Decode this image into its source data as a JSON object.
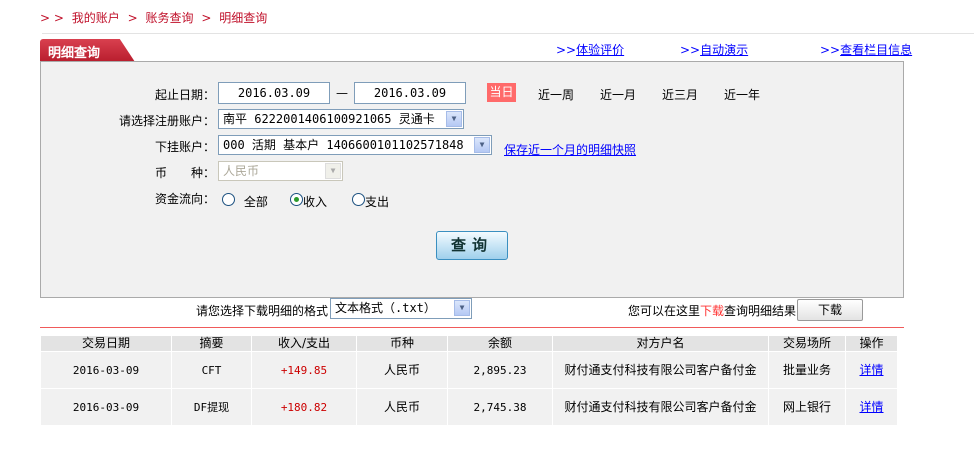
{
  "breadcrumb": {
    "prefix": "> >",
    "items": [
      "我的账户",
      "账务查询",
      "明细查询"
    ],
    "sep": ">"
  },
  "tab": {
    "title": "明细查询"
  },
  "top_links": [
    {
      "prefix": ">>",
      "label": "体验评价"
    },
    {
      "prefix": ">>",
      "label": "自动演示"
    },
    {
      "prefix": ">>",
      "label": "查看栏目信息"
    }
  ],
  "form": {
    "date_label": "起止日期：",
    "start_date": "2016.03.09",
    "dash": "—",
    "end_date": "2016.03.09",
    "quick": [
      "当日",
      "近一周",
      "近一月",
      "近三月",
      "近一年"
    ],
    "account_label": "请选择注册账户：",
    "account_value": "南平  6222001406100921065  灵通卡",
    "sub_label": "下挂账户：",
    "sub_value": "000  活期  基本户  1406600101102571848",
    "snapshot_link": "保存近一个月的明细快照",
    "currency_label": "币　　种：",
    "currency_value": "人民币",
    "flow_label": "资金流向：",
    "flow_options": [
      "全部",
      "收入",
      "支出"
    ],
    "flow_selected": "收入",
    "query_button": "查询"
  },
  "download": {
    "format_label": "请您选择下载明细的格式",
    "format_value": "文本格式（.txt）",
    "hint_pre": "您可以在这里",
    "hint_red": "下载",
    "hint_post": "查询明细结果",
    "button": "下载"
  },
  "table": {
    "headers": [
      "交易日期",
      "摘要",
      "收入/支出",
      "币种",
      "余额",
      "对方户名",
      "交易场所",
      "操作"
    ],
    "rows": [
      [
        "2016-03-09",
        "CFT",
        "+149.85",
        "人民币",
        "2,895.23",
        "财付通支付科技有限公司客户备付金",
        "批量业务",
        "详情"
      ],
      [
        "2016-03-09",
        "DF提现",
        "+180.82",
        "人民币",
        "2,745.38",
        "财付通支付科技有限公司客户备付金",
        "网上银行",
        "详情"
      ]
    ]
  },
  "colors": {
    "brand_red": "#c0102a",
    "today_bg": "#ff6a6a",
    "amount": "#cc0000",
    "link": "#0000ff"
  }
}
